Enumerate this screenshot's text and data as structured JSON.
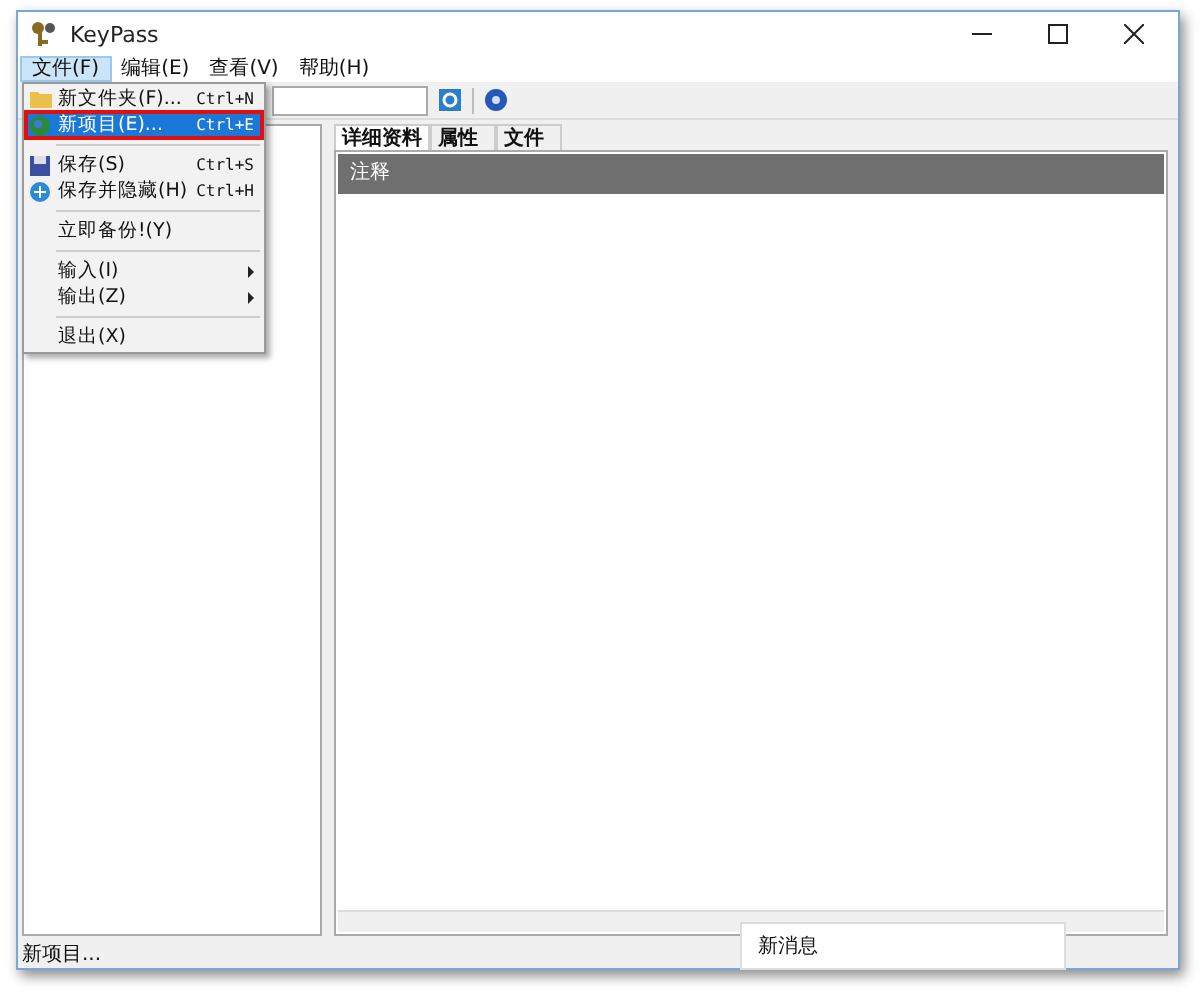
{
  "window": {
    "title": "KeyPass"
  },
  "menu_bar": [
    {
      "label": "文件(F)",
      "selected": true
    },
    {
      "label": "编辑(E)",
      "selected": false
    },
    {
      "label": "查看(V)",
      "selected": false
    },
    {
      "label": "帮助(H)",
      "selected": false
    }
  ],
  "file_menu": [
    {
      "kind": "item",
      "label": "新文件夹(F)...",
      "shortcut": "Ctrl+N",
      "selected": false,
      "submenu": false
    },
    {
      "kind": "item",
      "label": "新项目(E)...",
      "shortcut": "Ctrl+E",
      "selected": true,
      "submenu": false
    },
    {
      "kind": "separator"
    },
    {
      "kind": "item",
      "label": "保存(S)",
      "shortcut": "Ctrl+S",
      "selected": false,
      "submenu": false
    },
    {
      "kind": "item",
      "label": "保存并隐藏(H)",
      "shortcut": "Ctrl+H",
      "selected": false,
      "submenu": false
    },
    {
      "kind": "separator"
    },
    {
      "kind": "item",
      "label": "立即备份!(Y)",
      "selected": false,
      "submenu": false
    },
    {
      "kind": "separator"
    },
    {
      "kind": "item",
      "label": "输入(I)",
      "selected": false,
      "submenu": true
    },
    {
      "kind": "item",
      "label": "输出(Z)",
      "selected": false,
      "submenu": true
    },
    {
      "kind": "separator"
    },
    {
      "kind": "item",
      "label": "退出(X)",
      "selected": false,
      "submenu": false
    }
  ],
  "tabs": [
    {
      "label": "详细资料",
      "selected": true
    },
    {
      "label": "属性",
      "selected": false
    },
    {
      "label": "文件",
      "selected": false
    }
  ],
  "notes_header": "注释",
  "status_bar": "新项目...",
  "notification": "新消息"
}
